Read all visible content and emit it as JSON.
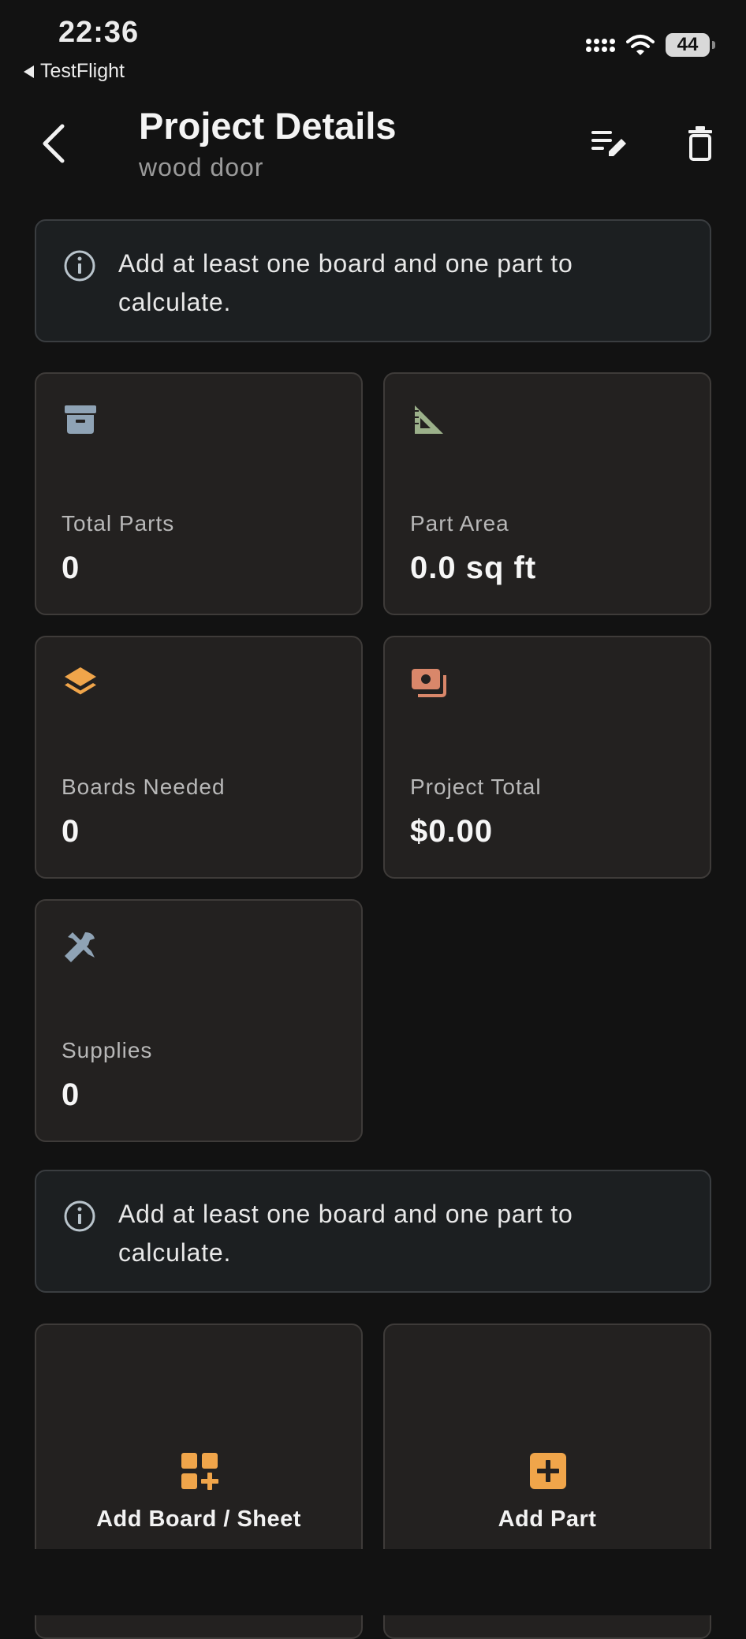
{
  "status_bar": {
    "time": "22:36",
    "back_app": "TestFlight",
    "battery": "44",
    "icons": [
      "signal-icon",
      "wifi-icon",
      "battery-icon"
    ]
  },
  "header": {
    "title": "Project Details",
    "subtitle": "wood door",
    "icons": [
      "back-arrow-icon",
      "edit-list-icon",
      "trash-icon"
    ]
  },
  "banner_top": {
    "message": "Add at least one board and one part to calculate.",
    "icon": "info-icon"
  },
  "stats": [
    {
      "label": "Total Parts",
      "value": "0",
      "icon": "archive-box-icon",
      "color": "#8fa3b5"
    },
    {
      "label": "Part Area",
      "value": "0.0 sq ft",
      "icon": "set-square-icon",
      "color": "#9bb08a"
    },
    {
      "label": "Boards Needed",
      "value": "0",
      "icon": "layers-icon",
      "color": "#f0a54a"
    },
    {
      "label": "Project Total",
      "value": "$0.00",
      "icon": "money-icon",
      "color": "#d9876a"
    },
    {
      "label": "Supplies",
      "value": "0",
      "icon": "tools-icon",
      "color": "#8fa3b5"
    }
  ],
  "banner_bottom": {
    "message": "Add at least one board and one part to calculate.",
    "icon": "info-icon"
  },
  "actions": {
    "add_board": {
      "label": "Add Board / Sheet",
      "icon": "grid-plus-icon",
      "color": "#f0a54a"
    },
    "add_part": {
      "label": "Add Part",
      "icon": "plus-square-icon",
      "color": "#f0a54a"
    }
  },
  "colors": {
    "background": "#121212",
    "card": "#232120",
    "banner": "#1c1f21",
    "accent": "#f0a54a"
  }
}
